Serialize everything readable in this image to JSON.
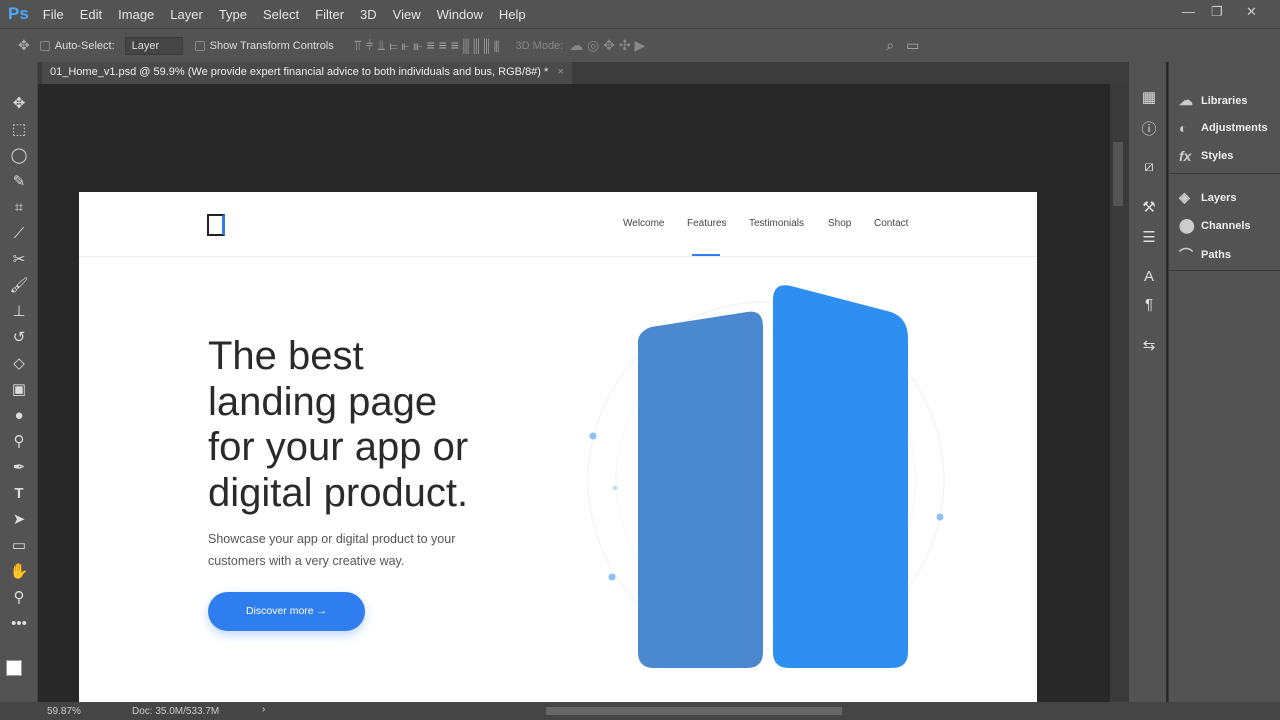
{
  "app": {
    "logo": "Ps",
    "menu": [
      "File",
      "Edit",
      "Image",
      "Layer",
      "Type",
      "Select",
      "Filter",
      "3D",
      "View",
      "Window",
      "Help"
    ]
  },
  "options": {
    "auto_select": "Auto-Select:",
    "layer_select": "Layer",
    "show_transform": "Show Transform Controls",
    "mode_3d": "3D Mode:"
  },
  "tab": {
    "title": "01_Home_v1.psd @ 59.9% (We provide expert financial advice  to both individuals and bus, RGB/8#) *",
    "close": "×"
  },
  "doc": {
    "nav": [
      "Welcome",
      "Features",
      "Testimonials",
      "Shop",
      "Contact"
    ],
    "active_nav": "Features",
    "headline": [
      "The best",
      "landing page",
      "for your app or",
      "digital product."
    ],
    "paragraph": [
      "Showcase your app or digital product to your",
      "customers with a very creative way."
    ],
    "button": "Discover more  →"
  },
  "panels": [
    {
      "label": "Libraries"
    },
    {
      "label": "Adjustments"
    },
    {
      "label": "Styles"
    },
    {
      "label": "Layers"
    },
    {
      "label": "Channels"
    },
    {
      "label": "Paths"
    }
  ],
  "status": {
    "zoom": "59.87%",
    "doc": "Doc: 35.0M/533.7M"
  },
  "colors": {
    "accent": "#2e7ef0",
    "shape_left": "#4a88cf",
    "shape_right": "#2e8ff0"
  }
}
